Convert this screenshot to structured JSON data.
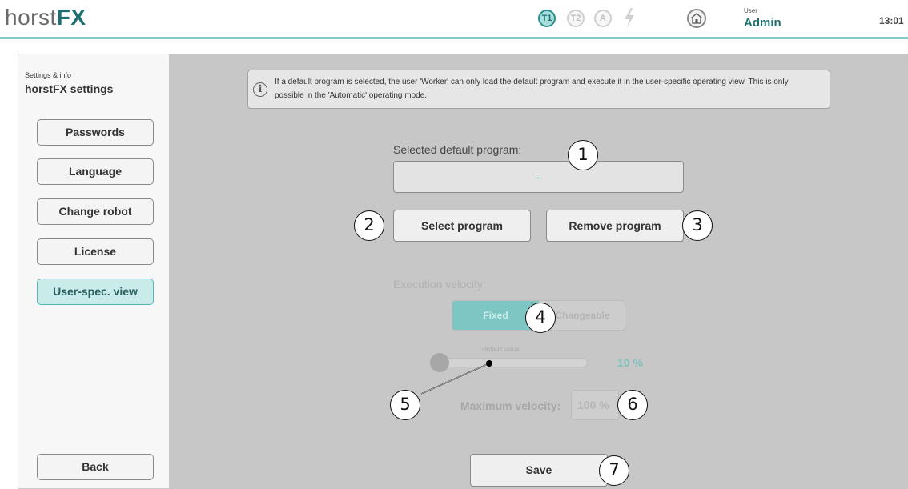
{
  "header": {
    "logo_light": "horst",
    "logo_bold": "FX",
    "modes": [
      {
        "label": "T1",
        "active": true
      },
      {
        "label": "T2",
        "active": false
      },
      {
        "label": "A",
        "active": false
      }
    ],
    "user_caption": "User",
    "user_name": "Admin",
    "time": "13:01"
  },
  "sidebar": {
    "caption": "Settings & info",
    "title": "horstFX settings",
    "items": [
      {
        "label": "Passwords"
      },
      {
        "label": "Language"
      },
      {
        "label": "Change robot"
      },
      {
        "label": "License"
      },
      {
        "label": "User-spec. view",
        "active": true
      }
    ],
    "back_label": "Back"
  },
  "main": {
    "info_text": "If a default program is selected, the user 'Worker' can only load the default program and execute it in the user-specific operating view. This is only possible in the 'Automatic' operating mode.",
    "default_program_label": "Selected default program:",
    "default_program_value": "-",
    "select_program_label": "Select program",
    "remove_program_label": "Remove program",
    "execution_velocity_label": "Execution velocity:",
    "velocity_options": [
      "Fixed",
      "Changeable"
    ],
    "velocity_selected": "Fixed",
    "default_value_label": "Default value:",
    "default_value_percent": 10,
    "default_value_text": "10 %",
    "max_velocity_label": "Maximum velocity:",
    "max_velocity_value": "100 %",
    "save_label": "Save"
  },
  "callouts": [
    "1",
    "2",
    "3",
    "4",
    "5",
    "6",
    "7"
  ],
  "colors": {
    "accent": "#1e6f70",
    "accent_light": "#c9ecea",
    "header_line": "#7ecfcc",
    "panel_bg": "#c7c7c7"
  }
}
